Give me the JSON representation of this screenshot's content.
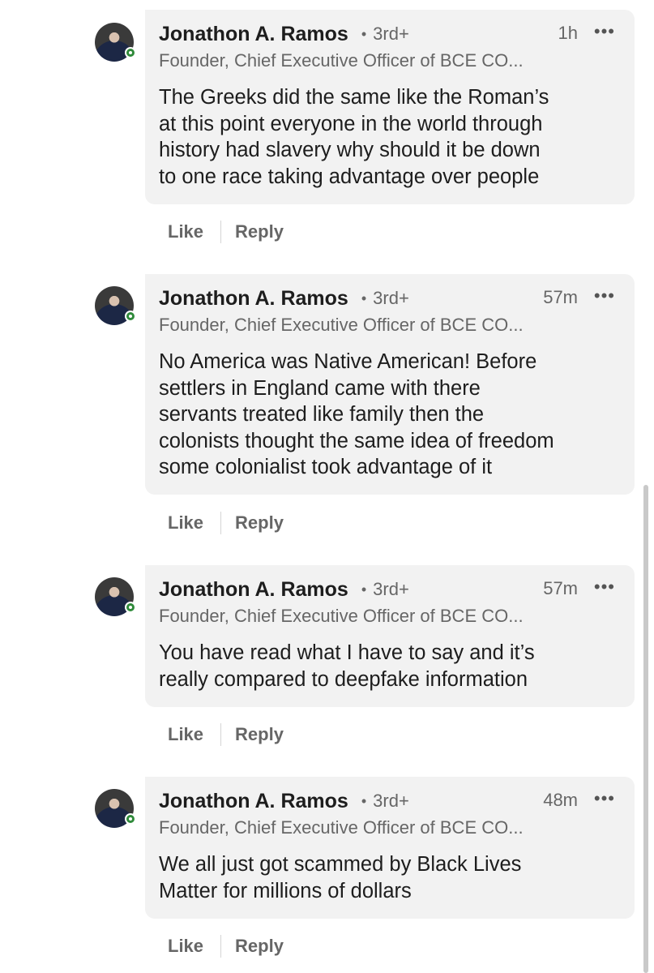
{
  "comments": [
    {
      "author": "Jonathon A. Ramos",
      "degree": "3rd+",
      "time": "1h",
      "headline": "Founder, Chief Executive Officer of BCE CO...",
      "text": "The Greeks did the same like the Roman’s\nat this point everyone in the world through\nhistory had slavery why should it be down\nto one race taking advantage over people",
      "like_label": "Like",
      "reply_label": "Reply"
    },
    {
      "author": "Jonathon A. Ramos",
      "degree": "3rd+",
      "time": "57m",
      "headline": "Founder, Chief Executive Officer of BCE CO...",
      "text": "No America was Native American! Before\nsettlers in England came with there\nservants treated like family then the\ncolonists thought the same idea of freedom\nsome colonialist took advantage of it",
      "like_label": "Like",
      "reply_label": "Reply"
    },
    {
      "author": "Jonathon A. Ramos",
      "degree": "3rd+",
      "time": "57m",
      "headline": "Founder, Chief Executive Officer of BCE CO...",
      "text": "You have read what I have to say and it’s\nreally compared to deepfake information",
      "like_label": "Like",
      "reply_label": "Reply"
    },
    {
      "author": "Jonathon A. Ramos",
      "degree": "3rd+",
      "time": "48m",
      "headline": "Founder, Chief Executive Officer of BCE CO...",
      "text": "We all just got scammed by Black Lives\nMatter for millions of dollars",
      "like_label": "Like",
      "reply_label": "Reply"
    }
  ],
  "separator_dot": "•",
  "more_icon": "•••",
  "colors": {
    "bubble_bg": "#f2f2f2",
    "presence_green": "#2f8a3a",
    "secondary_text": "#666666"
  }
}
